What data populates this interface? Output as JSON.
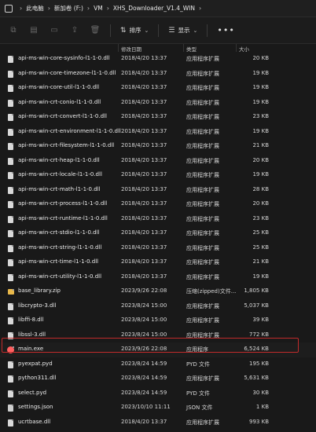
{
  "breadcrumb": [
    "此电脑",
    "新加卷 (F:)",
    "VM",
    "XHS_Downloader_V1.4_WIN"
  ],
  "toolbar": {
    "sort_label": "排序",
    "view_label": "显示",
    "more_label": "•••"
  },
  "columns": {
    "date": "修改日期",
    "type": "类型",
    "size": "大小"
  },
  "files": [
    {
      "name": "api-ms-win-core-sysinfo-l1-1-0.dll",
      "date": "2018/4/20 13:37",
      "type": "应用程序扩展",
      "size": "20 KB",
      "icon": "file"
    },
    {
      "name": "api-ms-win-core-timezone-l1-1-0.dll",
      "date": "2018/4/20 13:37",
      "type": "应用程序扩展",
      "size": "19 KB",
      "icon": "file"
    },
    {
      "name": "api-ms-win-core-util-l1-1-0.dll",
      "date": "2018/4/20 13:37",
      "type": "应用程序扩展",
      "size": "19 KB",
      "icon": "file"
    },
    {
      "name": "api-ms-win-crt-conio-l1-1-0.dll",
      "date": "2018/4/20 13:37",
      "type": "应用程序扩展",
      "size": "19 KB",
      "icon": "file"
    },
    {
      "name": "api-ms-win-crt-convert-l1-1-0.dll",
      "date": "2018/4/20 13:37",
      "type": "应用程序扩展",
      "size": "23 KB",
      "icon": "file"
    },
    {
      "name": "api-ms-win-crt-environment-l1-1-0.dll",
      "date": "2018/4/20 13:37",
      "type": "应用程序扩展",
      "size": "19 KB",
      "icon": "file"
    },
    {
      "name": "api-ms-win-crt-filesystem-l1-1-0.dll",
      "date": "2018/4/20 13:37",
      "type": "应用程序扩展",
      "size": "21 KB",
      "icon": "file"
    },
    {
      "name": "api-ms-win-crt-heap-l1-1-0.dll",
      "date": "2018/4/20 13:37",
      "type": "应用程序扩展",
      "size": "20 KB",
      "icon": "file"
    },
    {
      "name": "api-ms-win-crt-locale-l1-1-0.dll",
      "date": "2018/4/20 13:37",
      "type": "应用程序扩展",
      "size": "19 KB",
      "icon": "file"
    },
    {
      "name": "api-ms-win-crt-math-l1-1-0.dll",
      "date": "2018/4/20 13:37",
      "type": "应用程序扩展",
      "size": "28 KB",
      "icon": "file"
    },
    {
      "name": "api-ms-win-crt-process-l1-1-0.dll",
      "date": "2018/4/20 13:37",
      "type": "应用程序扩展",
      "size": "20 KB",
      "icon": "file"
    },
    {
      "name": "api-ms-win-crt-runtime-l1-1-0.dll",
      "date": "2018/4/20 13:37",
      "type": "应用程序扩展",
      "size": "23 KB",
      "icon": "file"
    },
    {
      "name": "api-ms-win-crt-stdio-l1-1-0.dll",
      "date": "2018/4/20 13:37",
      "type": "应用程序扩展",
      "size": "25 KB",
      "icon": "file"
    },
    {
      "name": "api-ms-win-crt-string-l1-1-0.dll",
      "date": "2018/4/20 13:37",
      "type": "应用程序扩展",
      "size": "25 KB",
      "icon": "file"
    },
    {
      "name": "api-ms-win-crt-time-l1-1-0.dll",
      "date": "2018/4/20 13:37",
      "type": "应用程序扩展",
      "size": "21 KB",
      "icon": "file"
    },
    {
      "name": "api-ms-win-crt-utility-l1-1-0.dll",
      "date": "2018/4/20 13:37",
      "type": "应用程序扩展",
      "size": "19 KB",
      "icon": "file"
    },
    {
      "name": "base_library.zip",
      "date": "2023/9/26 22:08",
      "type": "压缩(zipped)文件...",
      "size": "1,805 KB",
      "icon": "folder"
    },
    {
      "name": "libcrypto-3.dll",
      "date": "2023/8/24 15:00",
      "type": "应用程序扩展",
      "size": "5,037 KB",
      "icon": "file"
    },
    {
      "name": "libffi-8.dll",
      "date": "2023/8/24 15:00",
      "type": "应用程序扩展",
      "size": "39 KB",
      "icon": "file"
    },
    {
      "name": "libssl-3.dll",
      "date": "2023/8/24 15:00",
      "type": "应用程序扩展",
      "size": "772 KB",
      "icon": "file"
    },
    {
      "name": "main.exe",
      "date": "2023/9/26 22:08",
      "type": "应用程序",
      "size": "6,524 KB",
      "icon": "exe"
    },
    {
      "name": "pyexpat.pyd",
      "date": "2023/8/24 14:59",
      "type": "PYD 文件",
      "size": "195 KB",
      "icon": "file"
    },
    {
      "name": "python311.dll",
      "date": "2023/8/24 14:59",
      "type": "应用程序扩展",
      "size": "5,631 KB",
      "icon": "file"
    },
    {
      "name": "select.pyd",
      "date": "2023/8/24 14:59",
      "type": "PYD 文件",
      "size": "30 KB",
      "icon": "file"
    },
    {
      "name": "settings.json",
      "date": "2023/10/10 11:11",
      "type": "JSON 文件",
      "size": "1 KB",
      "icon": "json"
    },
    {
      "name": "ucrtbase.dll",
      "date": "2018/4/20 13:37",
      "type": "应用程序扩展",
      "size": "993 KB",
      "icon": "file"
    }
  ]
}
